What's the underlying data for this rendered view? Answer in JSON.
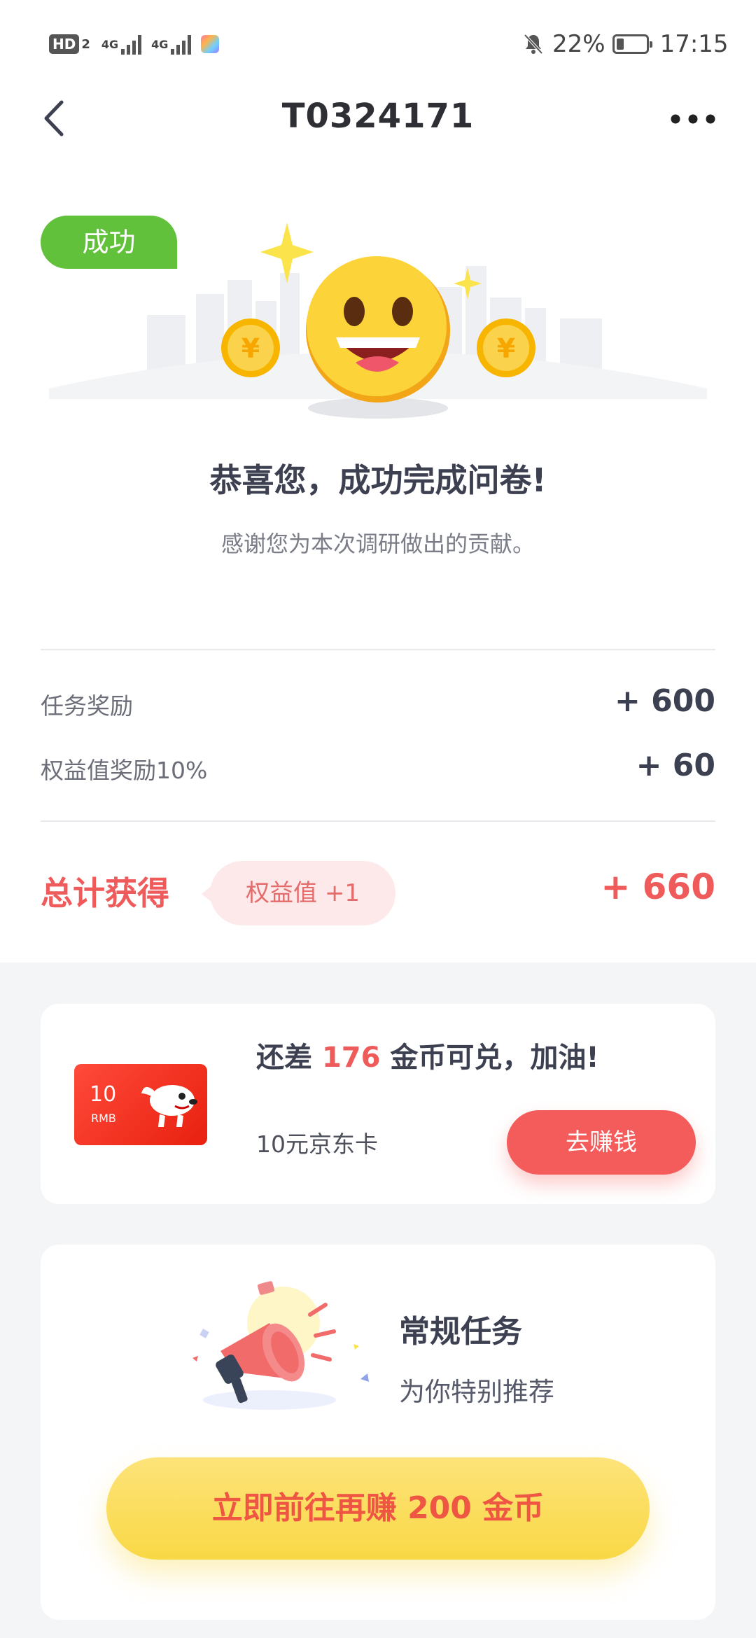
{
  "status_bar": {
    "hd_label": "HD",
    "hd_sub": "2",
    "network_1": "4G",
    "network_2": "4G",
    "battery": "22%",
    "time": "17:15"
  },
  "nav": {
    "title": "T0324171"
  },
  "result": {
    "badge": "成功",
    "coin_symbol": "¥",
    "heading": "恭喜您，成功完成问卷!",
    "subtitle": "感谢您为本次调研做出的贡献。"
  },
  "rewards": [
    {
      "label": "任务奖励",
      "value": "+ 600"
    },
    {
      "label": "权益值奖励10%",
      "value": "+ 60"
    }
  ],
  "total": {
    "label": "总计获得",
    "pill": "权益值 +1",
    "value": "+ 660"
  },
  "exchange_card": {
    "prefix": "还差 ",
    "amount": "176",
    "suffix": " 金币可兑，加油!",
    "card_value": "10",
    "card_unit": "RMB",
    "item_name": "10元京东卡",
    "button": "去赚钱"
  },
  "task_card": {
    "title": "常规任务",
    "subtitle": "为你特别推荐",
    "button": "立即前往再赚 200 金币"
  },
  "colors": {
    "accent_red": "#ef5a5a",
    "success_green": "#62c13b",
    "cta_yellow": "#f9d845"
  }
}
